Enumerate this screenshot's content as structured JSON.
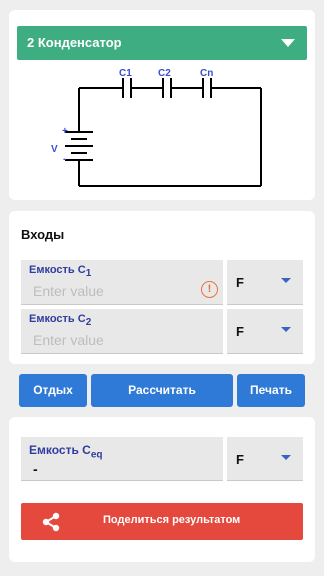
{
  "selector": {
    "selected": "2 Конденсатор",
    "chevron": "chevron-down-icon"
  },
  "circuit": {
    "labels": {
      "c1": "C1",
      "c2": "C2",
      "cn": "Cn",
      "voltage": "V",
      "plus": "+",
      "minus": "-"
    },
    "label_color": "#3a4fd0"
  },
  "inputs": {
    "title": "Входы",
    "field1": {
      "label": "Емкость C",
      "sub": "1",
      "placeholder": "Enter value",
      "unit": "F",
      "warning": "!"
    },
    "field2": {
      "label": "Емкость C",
      "sub": "2",
      "placeholder": "Enter value",
      "unit": "F"
    }
  },
  "buttons": {
    "rest": "Отдых",
    "calculate": "Рассчитать",
    "print": "Печать"
  },
  "result": {
    "label": "Емкость C",
    "sub": "eq",
    "value": "-",
    "unit": "F",
    "share": "Поделиться результатом"
  },
  "colors": {
    "header": "#3fad82",
    "button": "#2f7ad6",
    "share": "#e5483d",
    "label": "#2f3e9e"
  }
}
